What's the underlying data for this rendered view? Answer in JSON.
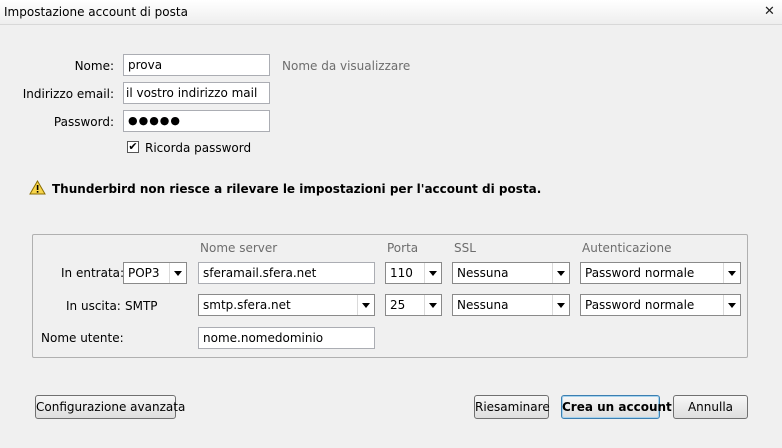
{
  "window": {
    "title": "Impostazione account di posta",
    "close_glyph": "✕"
  },
  "identity": {
    "name_label": "Nome:",
    "name_value": "prova",
    "name_hint": "Nome da visualizzare",
    "email_label": "Indirizzo email:",
    "email_value": "il vostro indirizzo mail",
    "password_label": "Password:",
    "password_value": "●●●●●",
    "remember_label": "Ricorda password",
    "remember_checked": true
  },
  "warning": {
    "icon": "warning-triangle-icon",
    "text": "Thunderbird non riesce a rilevare le impostazioni per l'account di posta."
  },
  "server_settings": {
    "headers": {
      "server": "Nome server",
      "port": "Porta",
      "ssl": "SSL",
      "auth": "Autenticazione"
    },
    "incoming": {
      "label": "In entrata:",
      "protocol": "POP3",
      "server": "sferamail.sfera.net",
      "port": "110",
      "ssl": "Nessuna",
      "auth": "Password normale"
    },
    "outgoing": {
      "label": "In uscita:",
      "protocol": "SMTP",
      "server": "smtp.sfera.net",
      "port": "25",
      "ssl": "Nessuna",
      "auth": "Password normale"
    },
    "username": {
      "label": "Nome utente:",
      "value": "nome.nomedominio"
    }
  },
  "buttons": {
    "advanced": "Configurazione avanzata",
    "retest": "Riesaminare",
    "create": "Crea un account",
    "cancel": "Annulla"
  }
}
